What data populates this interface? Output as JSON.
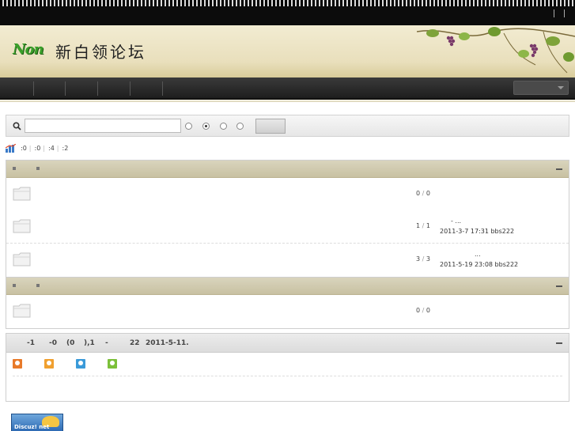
{
  "header": {
    "logo_mark": "Non",
    "site_title": "新白领论坛"
  },
  "search": {
    "placeholder": "",
    "value": ""
  },
  "stats": {
    "items": [
      ":0",
      ":0",
      ":4",
      ":2"
    ]
  },
  "groups": [
    {
      "forums": [
        {
          "topics": "0",
          "posts": "0",
          "last_line1": "",
          "last_line2": ""
        }
      ]
    },
    {
      "forums": [
        {
          "topics": "1",
          "posts": "1",
          "last_line1": "-      ...",
          "last_line2": "2011-3-7 17:31 bbs222"
        },
        {
          "topics": "3",
          "posts": "3",
          "last_line1": "...",
          "last_line2": "2011-5-19 23:08 bbs222"
        }
      ]
    },
    {
      "forums": [
        {
          "topics": "0",
          "posts": "0",
          "last_line1": "",
          "last_line2": ""
        }
      ]
    }
  ],
  "online": {
    "parts": [
      "-1",
      "-0",
      "(0",
      "),1",
      "-",
      "22",
      "2011-5-11."
    ]
  },
  "badge": {
    "text": "Discuz! net"
  },
  "colors": {
    "user_admin": "#e87a2a",
    "user_mod": "#f0a030",
    "user_member": "#3a9ad9",
    "user_guest": "#7cc03a"
  }
}
